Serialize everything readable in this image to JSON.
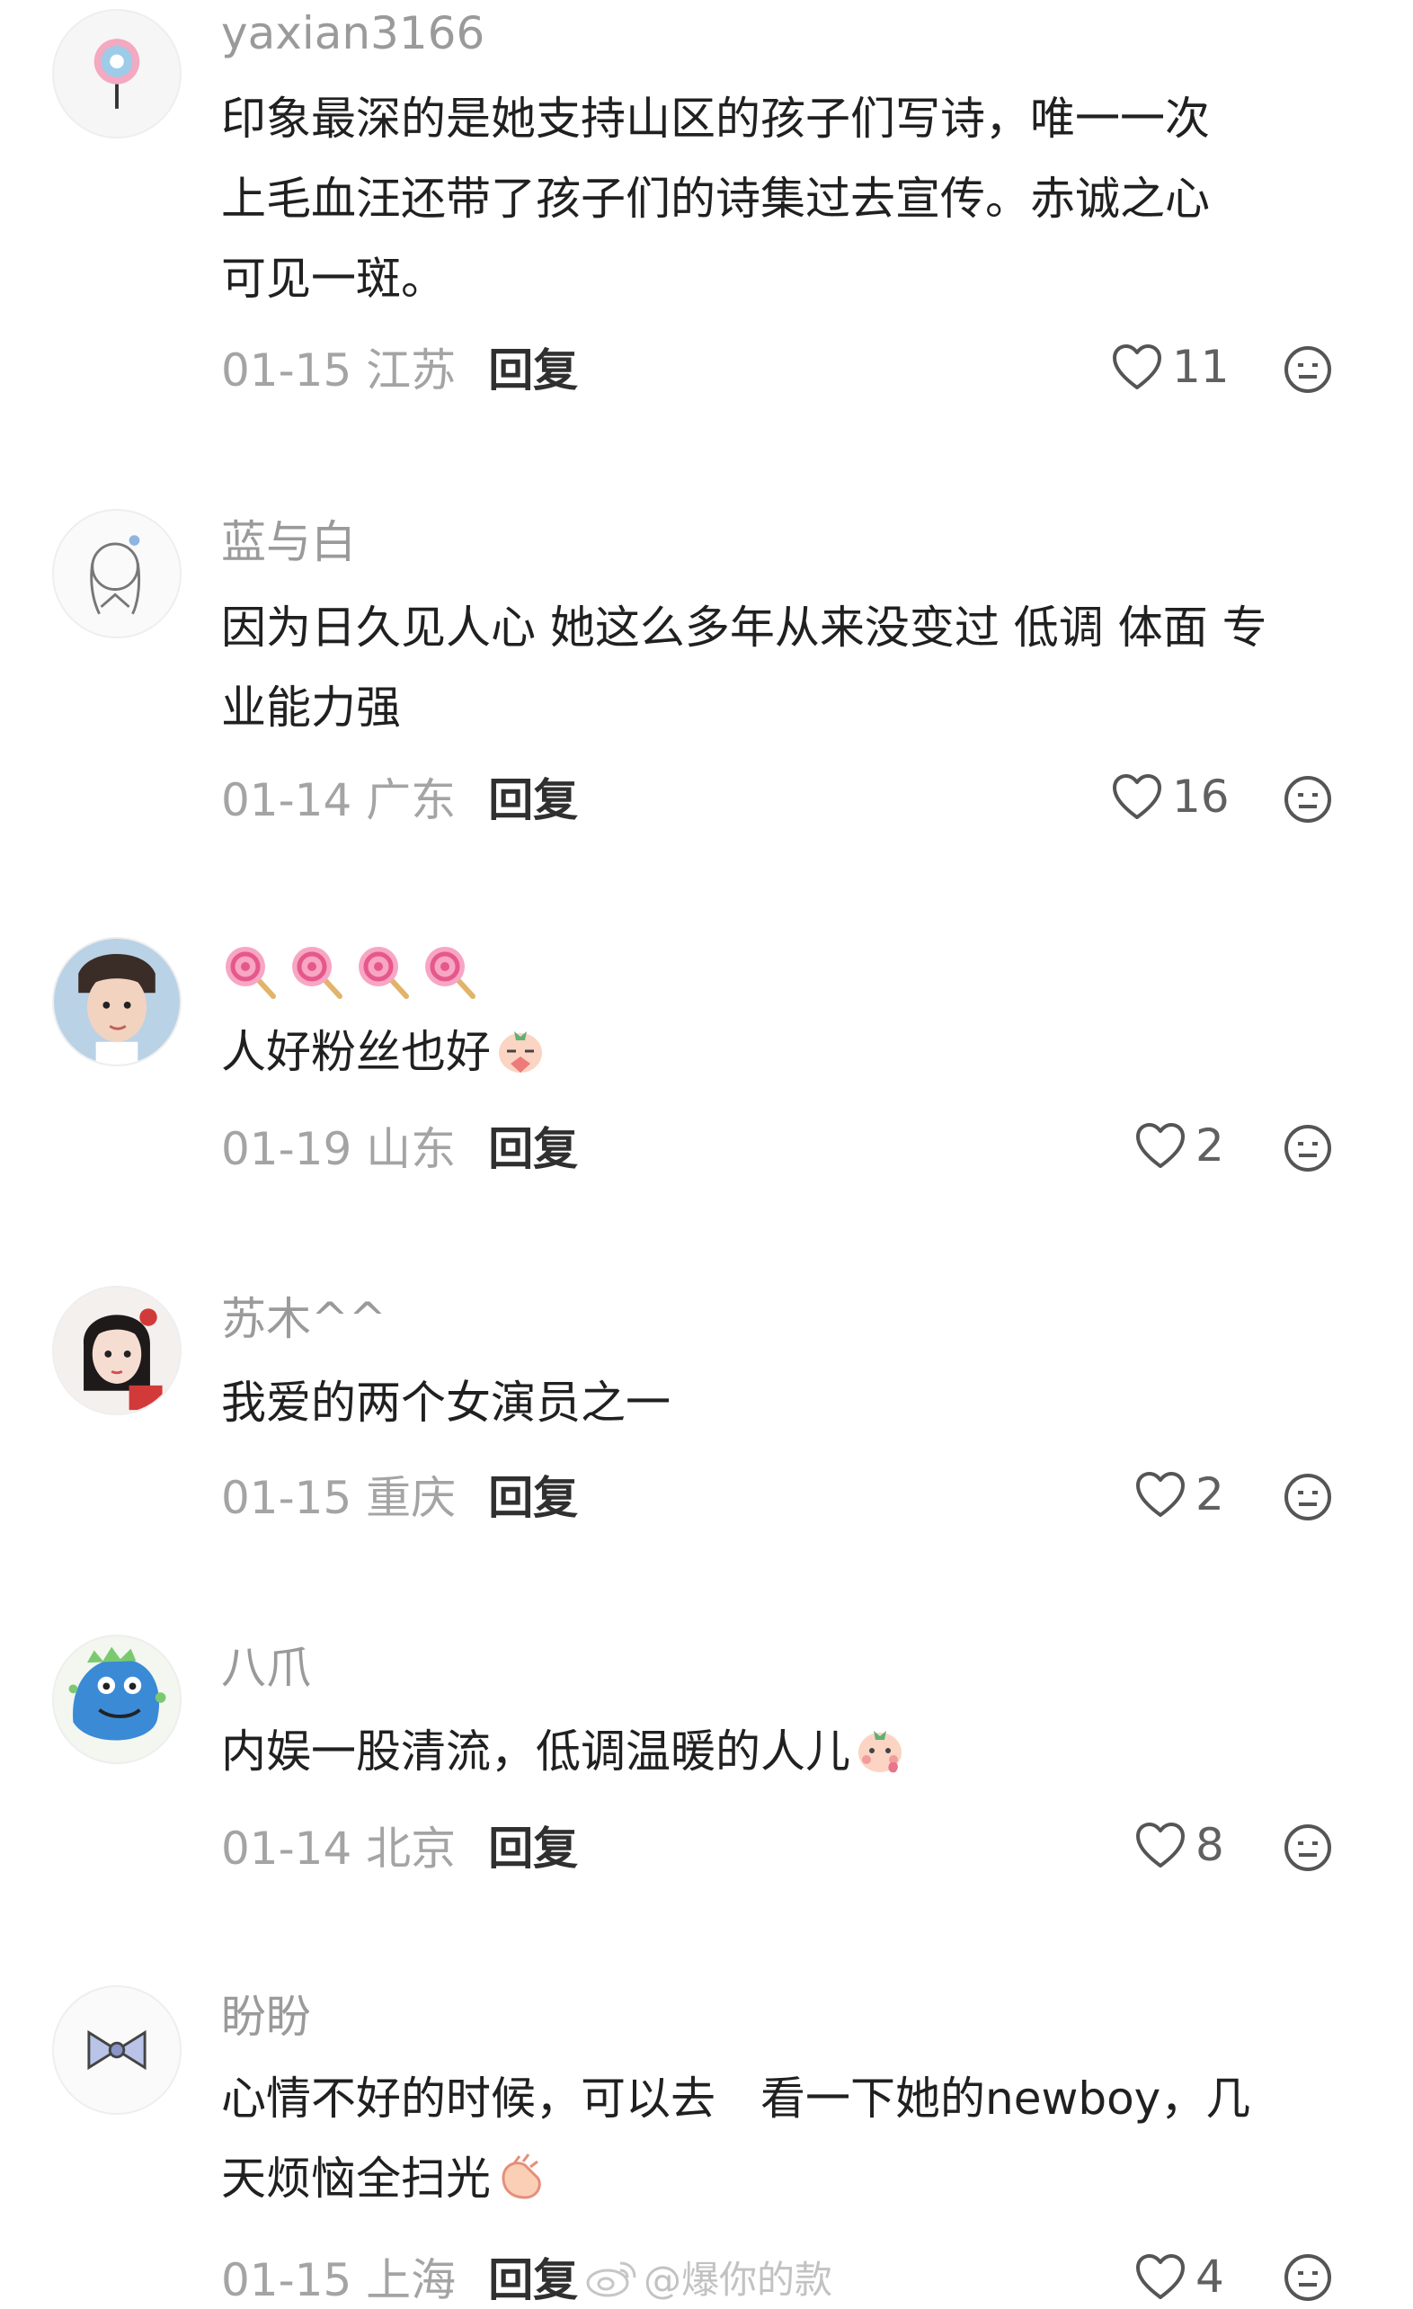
{
  "reply_label": "回复",
  "watermark": "@爆你的款",
  "comments": [
    {
      "user": "yaxian3166",
      "text": "印象最深的是她支持山区的孩子们写诗，唯一一次\n上毛血汪还带了孩子们的诗集过去宣传。赤诚之心\n可见一斑。",
      "date_loc": "01-15 江苏",
      "likes": "11"
    },
    {
      "user": "蓝与白",
      "text": "因为日久见人心 她这么多年从来没变过 低调 体面 专\n业能力强",
      "date_loc": "01-14 广东",
      "likes": "16"
    },
    {
      "user": "",
      "text": "人好粉丝也好",
      "date_loc": "01-19 山东",
      "likes": "2"
    },
    {
      "user": "苏木^^",
      "text": "我爱的两个女演员之一",
      "date_loc": "01-15 重庆",
      "likes": "2"
    },
    {
      "user": "八爪",
      "text": "内娱一股清流，低调温暖的人儿",
      "date_loc": "01-14 北京",
      "likes": "8"
    },
    {
      "user": "盼盼",
      "text": "心情不好的时候，可以去　看一下她的newboy，几\n天烦恼全扫光",
      "date_loc": "01-15 上海",
      "likes": "4"
    }
  ]
}
